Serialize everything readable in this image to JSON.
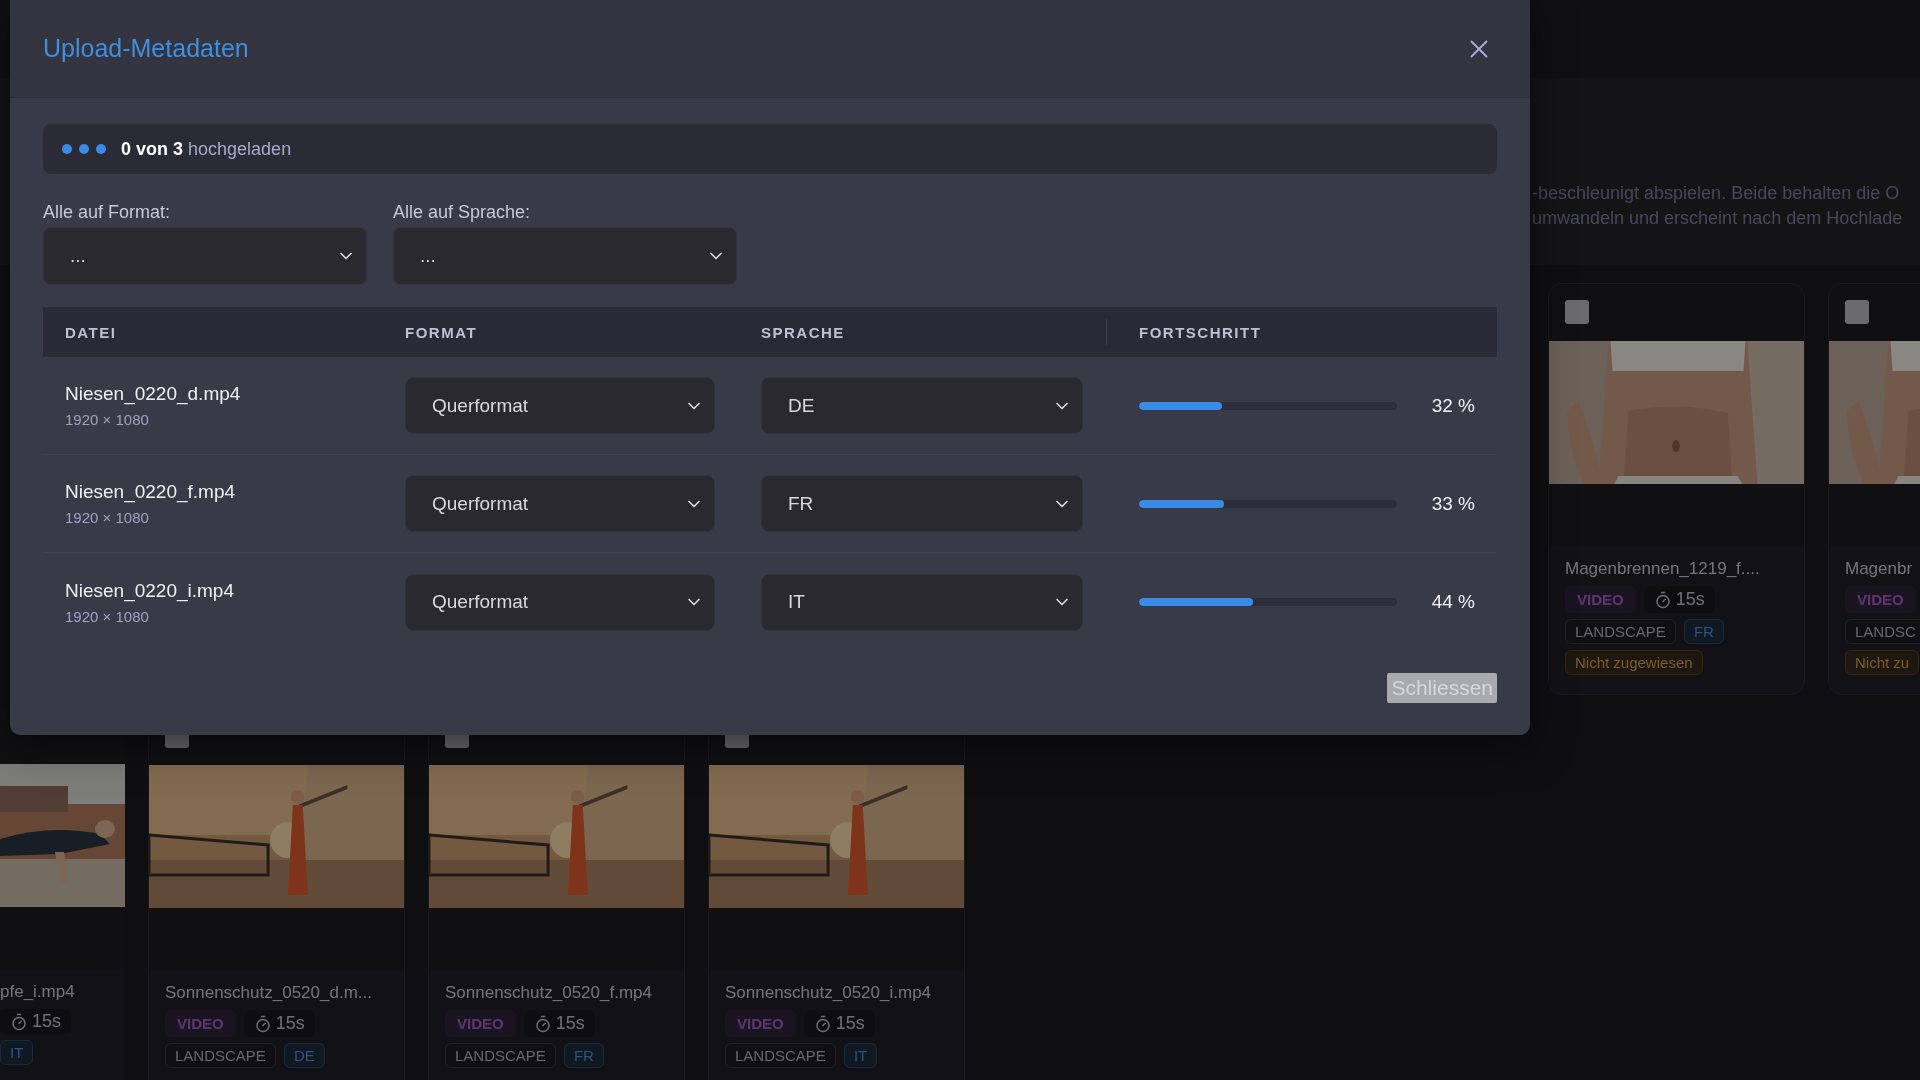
{
  "background": {
    "description_lines": [
      "-beschleunigt abspielen. Beide behalten die O",
      "umwandeln und erscheint nach dem Hochlade"
    ],
    "upper_cards": [
      {
        "checked": false,
        "title": "Magenbrennen_1219_f....",
        "type_badge": "VIDEO",
        "duration": "15s",
        "format_tag": "LANDSCAPE",
        "language_tag": "FR",
        "status": "Nicht zugewiesen"
      },
      {
        "checked": false,
        "title": "Magenbr",
        "type_badge": "VIDEO",
        "format_tag": "LANDSC",
        "status": "Nicht zu"
      }
    ],
    "lower_cards": [
      {
        "title": "pfe_i.mp4",
        "duration": "15s",
        "language_tag": "IT"
      },
      {
        "checked": false,
        "title": "Sonnenschutz_0520_d.m...",
        "type_badge": "VIDEO",
        "duration": "15s",
        "format_tag": "LANDSCAPE",
        "language_tag": "DE"
      },
      {
        "checked": false,
        "title": "Sonnenschutz_0520_f.mp4",
        "type_badge": "VIDEO",
        "duration": "15s",
        "format_tag": "LANDSCAPE",
        "language_tag": "FR"
      },
      {
        "checked": false,
        "title": "Sonnenschutz_0520_i.mp4",
        "type_badge": "VIDEO",
        "duration": "15s",
        "format_tag": "LANDSCAPE",
        "language_tag": "IT"
      }
    ]
  },
  "modal": {
    "title": "Upload-Metadaten",
    "status": {
      "count": "0 von 3",
      "label": "hochgeladen"
    },
    "bulk": [
      {
        "label": "Alle auf Format:",
        "value": "..."
      },
      {
        "label": "Alle auf Sprache:",
        "value": "..."
      }
    ],
    "columns": [
      "DATEI",
      "FORMAT",
      "SPRACHE",
      "FORTSCHRITT"
    ],
    "rows": [
      {
        "file": "Niesen_0220_d.mp4",
        "resolution": "1920 × 1080",
        "format": "Querformat",
        "language": "DE",
        "level": 0.32,
        "percent": "32 %"
      },
      {
        "file": "Niesen_0220_f.mp4",
        "resolution": "1920 × 1080",
        "format": "Querformat",
        "language": "FR",
        "level": 0.33,
        "percent": "33 %"
      },
      {
        "file": "Niesen_0220_i.mp4",
        "resolution": "1920 × 1080",
        "format": "Querformat",
        "language": "IT",
        "level": 0.44,
        "percent": "44 %"
      }
    ],
    "close_button": {
      "label": "Schliessen",
      "disabled": true
    }
  }
}
